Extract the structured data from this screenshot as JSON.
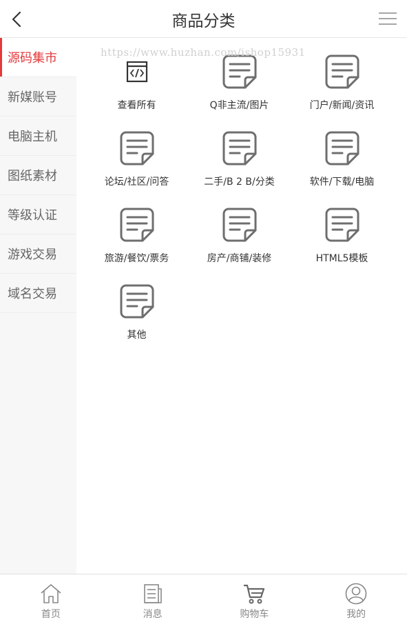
{
  "header": {
    "title": "商品分类",
    "back_icon": "chevron-left-icon",
    "menu_icon": "hamburger-menu-icon"
  },
  "sidebar": {
    "items": [
      {
        "label": "源码集市",
        "active": true
      },
      {
        "label": "新媒账号",
        "active": false
      },
      {
        "label": "电脑主机",
        "active": false
      },
      {
        "label": "图纸素材",
        "active": false
      },
      {
        "label": "等级认证",
        "active": false
      },
      {
        "label": "游戏交易",
        "active": false
      },
      {
        "label": "域名交易",
        "active": false
      }
    ]
  },
  "watermark": "https://www.huzhan.com/ishop15931",
  "categories": [
    {
      "label": "查看所有",
      "icon": "code-icon"
    },
    {
      "label": "Q非主流/图片",
      "icon": "document-icon"
    },
    {
      "label": "门户/新闻/资讯",
      "icon": "document-icon"
    },
    {
      "label": "论坛/社区/问答",
      "icon": "document-icon"
    },
    {
      "label": "二手/B 2 B/分类",
      "icon": "document-icon"
    },
    {
      "label": "软件/下载/电脑",
      "icon": "document-icon"
    },
    {
      "label": "旅游/餐饮/票务",
      "icon": "document-icon"
    },
    {
      "label": "房产/商铺/装修",
      "icon": "document-icon"
    },
    {
      "label": "HTML5模板",
      "icon": "document-icon"
    },
    {
      "label": "其他",
      "icon": "document-icon"
    }
  ],
  "bottom_nav": [
    {
      "label": "首页",
      "icon": "home-icon"
    },
    {
      "label": "消息",
      "icon": "message-icon"
    },
    {
      "label": "购物车",
      "icon": "cart-icon"
    },
    {
      "label": "我的",
      "icon": "user-icon"
    }
  ],
  "colors": {
    "accent": "#e4393c",
    "icon_gray": "#666666",
    "sidebar_bg": "#f7f7f7"
  }
}
